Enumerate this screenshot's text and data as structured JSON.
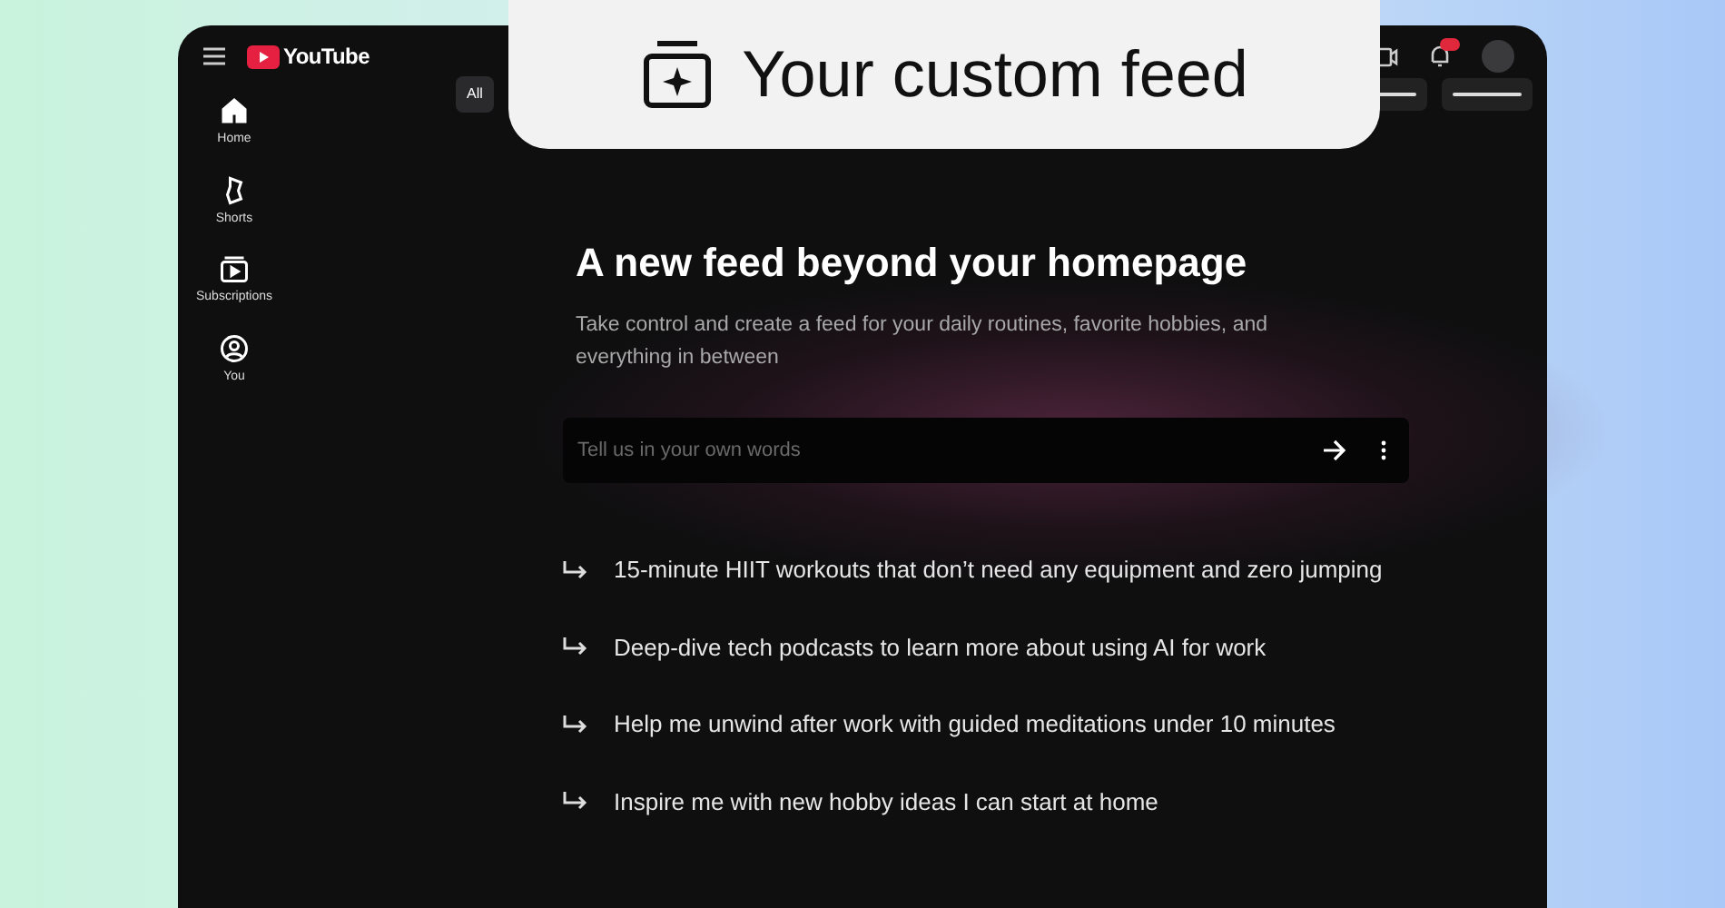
{
  "callout": {
    "title": "Your custom feed"
  },
  "header": {
    "logo": "YouTube"
  },
  "chips": [
    {
      "label": "All",
      "selected": true
    }
  ],
  "sidebar": {
    "items": [
      {
        "label": "Home"
      },
      {
        "label": "Shorts"
      },
      {
        "label": "Subscriptions"
      },
      {
        "label": "You"
      }
    ]
  },
  "feed": {
    "heading": "A new feed beyond your homepage",
    "description": "Take control and create a feed for your daily routines, favorite hobbies, and everything in between",
    "prompt": {
      "placeholder": "Tell us in your own words"
    },
    "suggestions": [
      "15-minute HIIT workouts that don’t need any equipment and zero jumping",
      "Deep-dive tech podcasts to learn more about using AI for work",
      "Help me unwind after work with guided meditations under 10 minutes",
      "Inspire me with new hobby ideas I can start at home"
    ]
  }
}
